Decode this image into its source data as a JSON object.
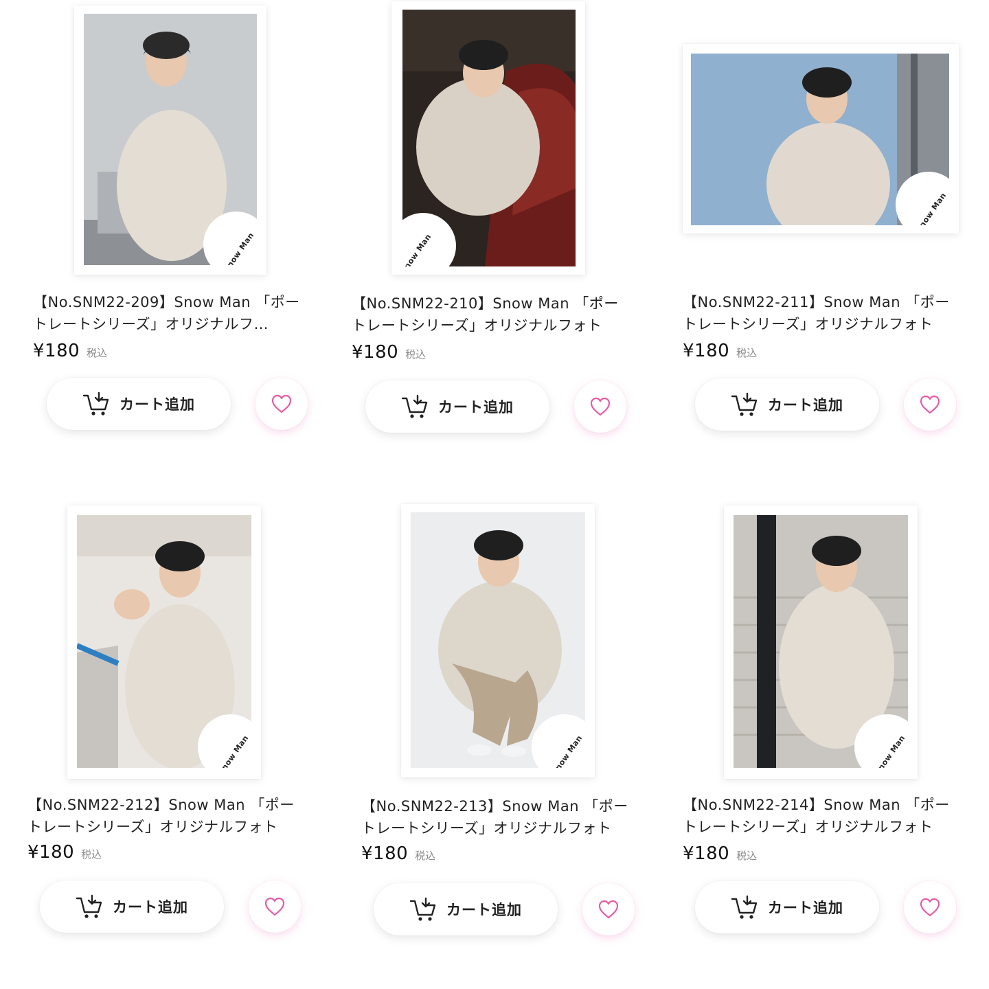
{
  "colors": {
    "heart": "#e85aa6",
    "text": "#222222",
    "tax": "#8a8a8a"
  },
  "products": [
    {
      "title": "【No.SNM22-209】Snow Man 「ポートレートシリーズ」オリジナルフ…",
      "price": "¥180",
      "tax_label": "税込",
      "cart_label": "カート追加",
      "logo": "Snow Man",
      "photo_orientation": "portrait",
      "cart_icon": "cart-add-icon",
      "fav_icon": "heart-icon"
    },
    {
      "title": "【No.SNM22-210】Snow Man 「ポートレートシリーズ」オリジナルフォト",
      "price": "¥180",
      "tax_label": "税込",
      "cart_label": "カート追加",
      "logo": "Snow Man",
      "photo_orientation": "portrait",
      "cart_icon": "cart-add-icon",
      "fav_icon": "heart-icon"
    },
    {
      "title": "【No.SNM22-211】Snow Man 「ポートレートシリーズ」オリジナルフォト",
      "price": "¥180",
      "tax_label": "税込",
      "cart_label": "カート追加",
      "logo": "Snow Man",
      "photo_orientation": "landscape",
      "cart_icon": "cart-add-icon",
      "fav_icon": "heart-icon"
    },
    {
      "title": "【No.SNM22-212】Snow Man 「ポートレートシリーズ」オリジナルフォト",
      "price": "¥180",
      "tax_label": "税込",
      "cart_label": "カート追加",
      "logo": "Snow Man",
      "photo_orientation": "portrait",
      "cart_icon": "cart-add-icon",
      "fav_icon": "heart-icon"
    },
    {
      "title": "【No.SNM22-213】Snow Man 「ポートレートシリーズ」オリジナルフォト",
      "price": "¥180",
      "tax_label": "税込",
      "cart_label": "カート追加",
      "logo": "Snow Man",
      "photo_orientation": "portrait",
      "cart_icon": "cart-add-icon",
      "fav_icon": "heart-icon"
    },
    {
      "title": "【No.SNM22-214】Snow Man 「ポートレートシリーズ」オリジナルフォト",
      "price": "¥180",
      "tax_label": "税込",
      "cart_label": "カート追加",
      "logo": "Snow Man",
      "photo_orientation": "portrait",
      "cart_icon": "cart-add-icon",
      "fav_icon": "heart-icon"
    }
  ]
}
